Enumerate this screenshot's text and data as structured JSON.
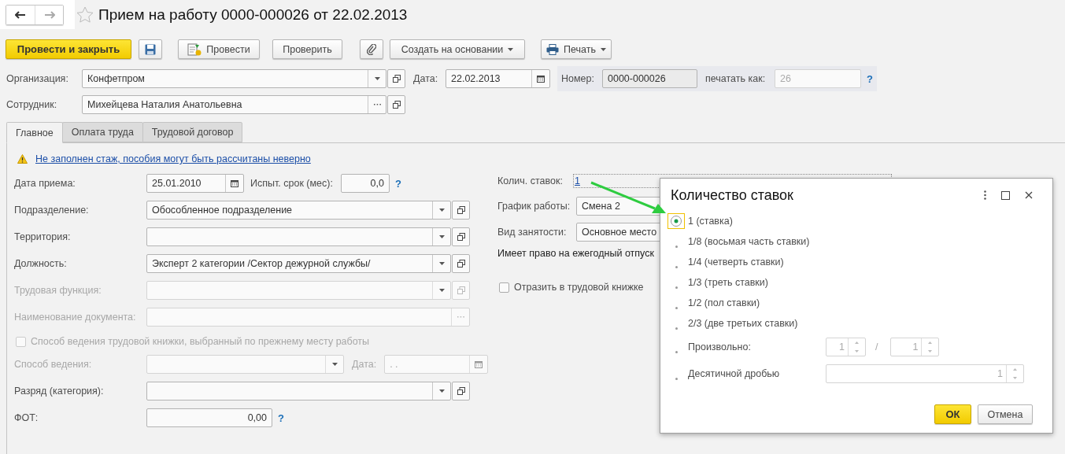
{
  "title": "Прием на работу 0000-000026 от 22.02.2013",
  "toolbar": {
    "post_close": "Провести и закрыть",
    "post": "Провести",
    "check": "Проверить",
    "create_based": "Создать на основании",
    "print": "Печать"
  },
  "header": {
    "organization": {
      "label": "Организация:",
      "value": "Конфетпром"
    },
    "date": {
      "label": "Дата:",
      "value": "22.02.2013"
    },
    "number": {
      "label": "Номер:",
      "value": "0000-000026"
    },
    "print_as": {
      "label": "печатать как:",
      "value": "26",
      "help": "?"
    },
    "employee": {
      "label": "Сотрудник:",
      "value": "Михейцева Наталия Анатольевна"
    }
  },
  "tabs": [
    {
      "label": "Главное",
      "selected": true
    },
    {
      "label": "Оплата труда",
      "selected": false
    },
    {
      "label": "Трудовой договор",
      "selected": false
    }
  ],
  "warning": "Не заполнен стаж, пособия могут быть рассчитаны неверно",
  "left_fields": [
    {
      "kind": "date_trial",
      "label": "Дата приема:",
      "value": "25.01.2010",
      "trial_label": "Испыт. срок (мес):",
      "trial_value": "0,0",
      "help": "?",
      "disabled": false
    },
    {
      "kind": "select",
      "label": "Подразделение:",
      "value": "Обособленное подразделение",
      "disabled": false
    },
    {
      "kind": "select",
      "label": "Территория:",
      "disabled": false
    },
    {
      "kind": "select",
      "label": "Должность:",
      "value": "Эксперт 2 категории /Сектор дежурной службы/",
      "disabled": false
    },
    {
      "kind": "select",
      "label": "Трудовая функция:",
      "disabled": true
    },
    {
      "kind": "choice",
      "label": "Наименование документа:",
      "disabled": true
    },
    {
      "kind": "checkbox",
      "label": "Способ ведения трудовой книжки, выбранный по прежнему месту работы",
      "checked": false,
      "disabled": true
    },
    {
      "kind": "select_date",
      "label": "Способ ведения:",
      "date_label": "Дата:",
      "date_value": ". .",
      "disabled": true
    },
    {
      "kind": "select",
      "label": "Разряд (категория):",
      "disabled": false
    },
    {
      "kind": "number",
      "label": "ФОТ:",
      "value": "0,00",
      "help": "?",
      "disabled": false
    }
  ],
  "right_fields": {
    "rates": {
      "label": "Колич. ставок:",
      "value": "1"
    },
    "schedule": {
      "label": "График работы:",
      "value": "Смена 2"
    },
    "employment": {
      "label": "Вид занятости:",
      "value": "Основное место"
    },
    "vacation": "Имеет право на ежегодный отпуск",
    "reflect": {
      "label": "Отразить в трудовой книжке",
      "checked": false
    }
  },
  "dialog": {
    "title": "Количество ставок",
    "options": [
      {
        "kind": "plain",
        "label": "1 (ставка)",
        "selected": true
      },
      {
        "kind": "plain",
        "label": "1/8 (восьмая часть ставки)",
        "selected": false
      },
      {
        "kind": "plain",
        "label": "1/4 (четверть ставки)",
        "selected": false
      },
      {
        "kind": "plain",
        "label": "1/3 (треть ставки)",
        "selected": false
      },
      {
        "kind": "plain",
        "label": "1/2 (пол ставки)",
        "selected": false
      },
      {
        "kind": "plain",
        "label": "2/3 (две третьих ставки)",
        "selected": false
      },
      {
        "kind": "fraction",
        "label": "Произвольно:",
        "numerator": "1",
        "separator": "/",
        "denominator": "1",
        "selected": false
      },
      {
        "kind": "decimal",
        "label": "Десятичной дробью",
        "value": "1",
        "selected": false
      }
    ],
    "ok": "ОК",
    "cancel": "Отмена"
  }
}
